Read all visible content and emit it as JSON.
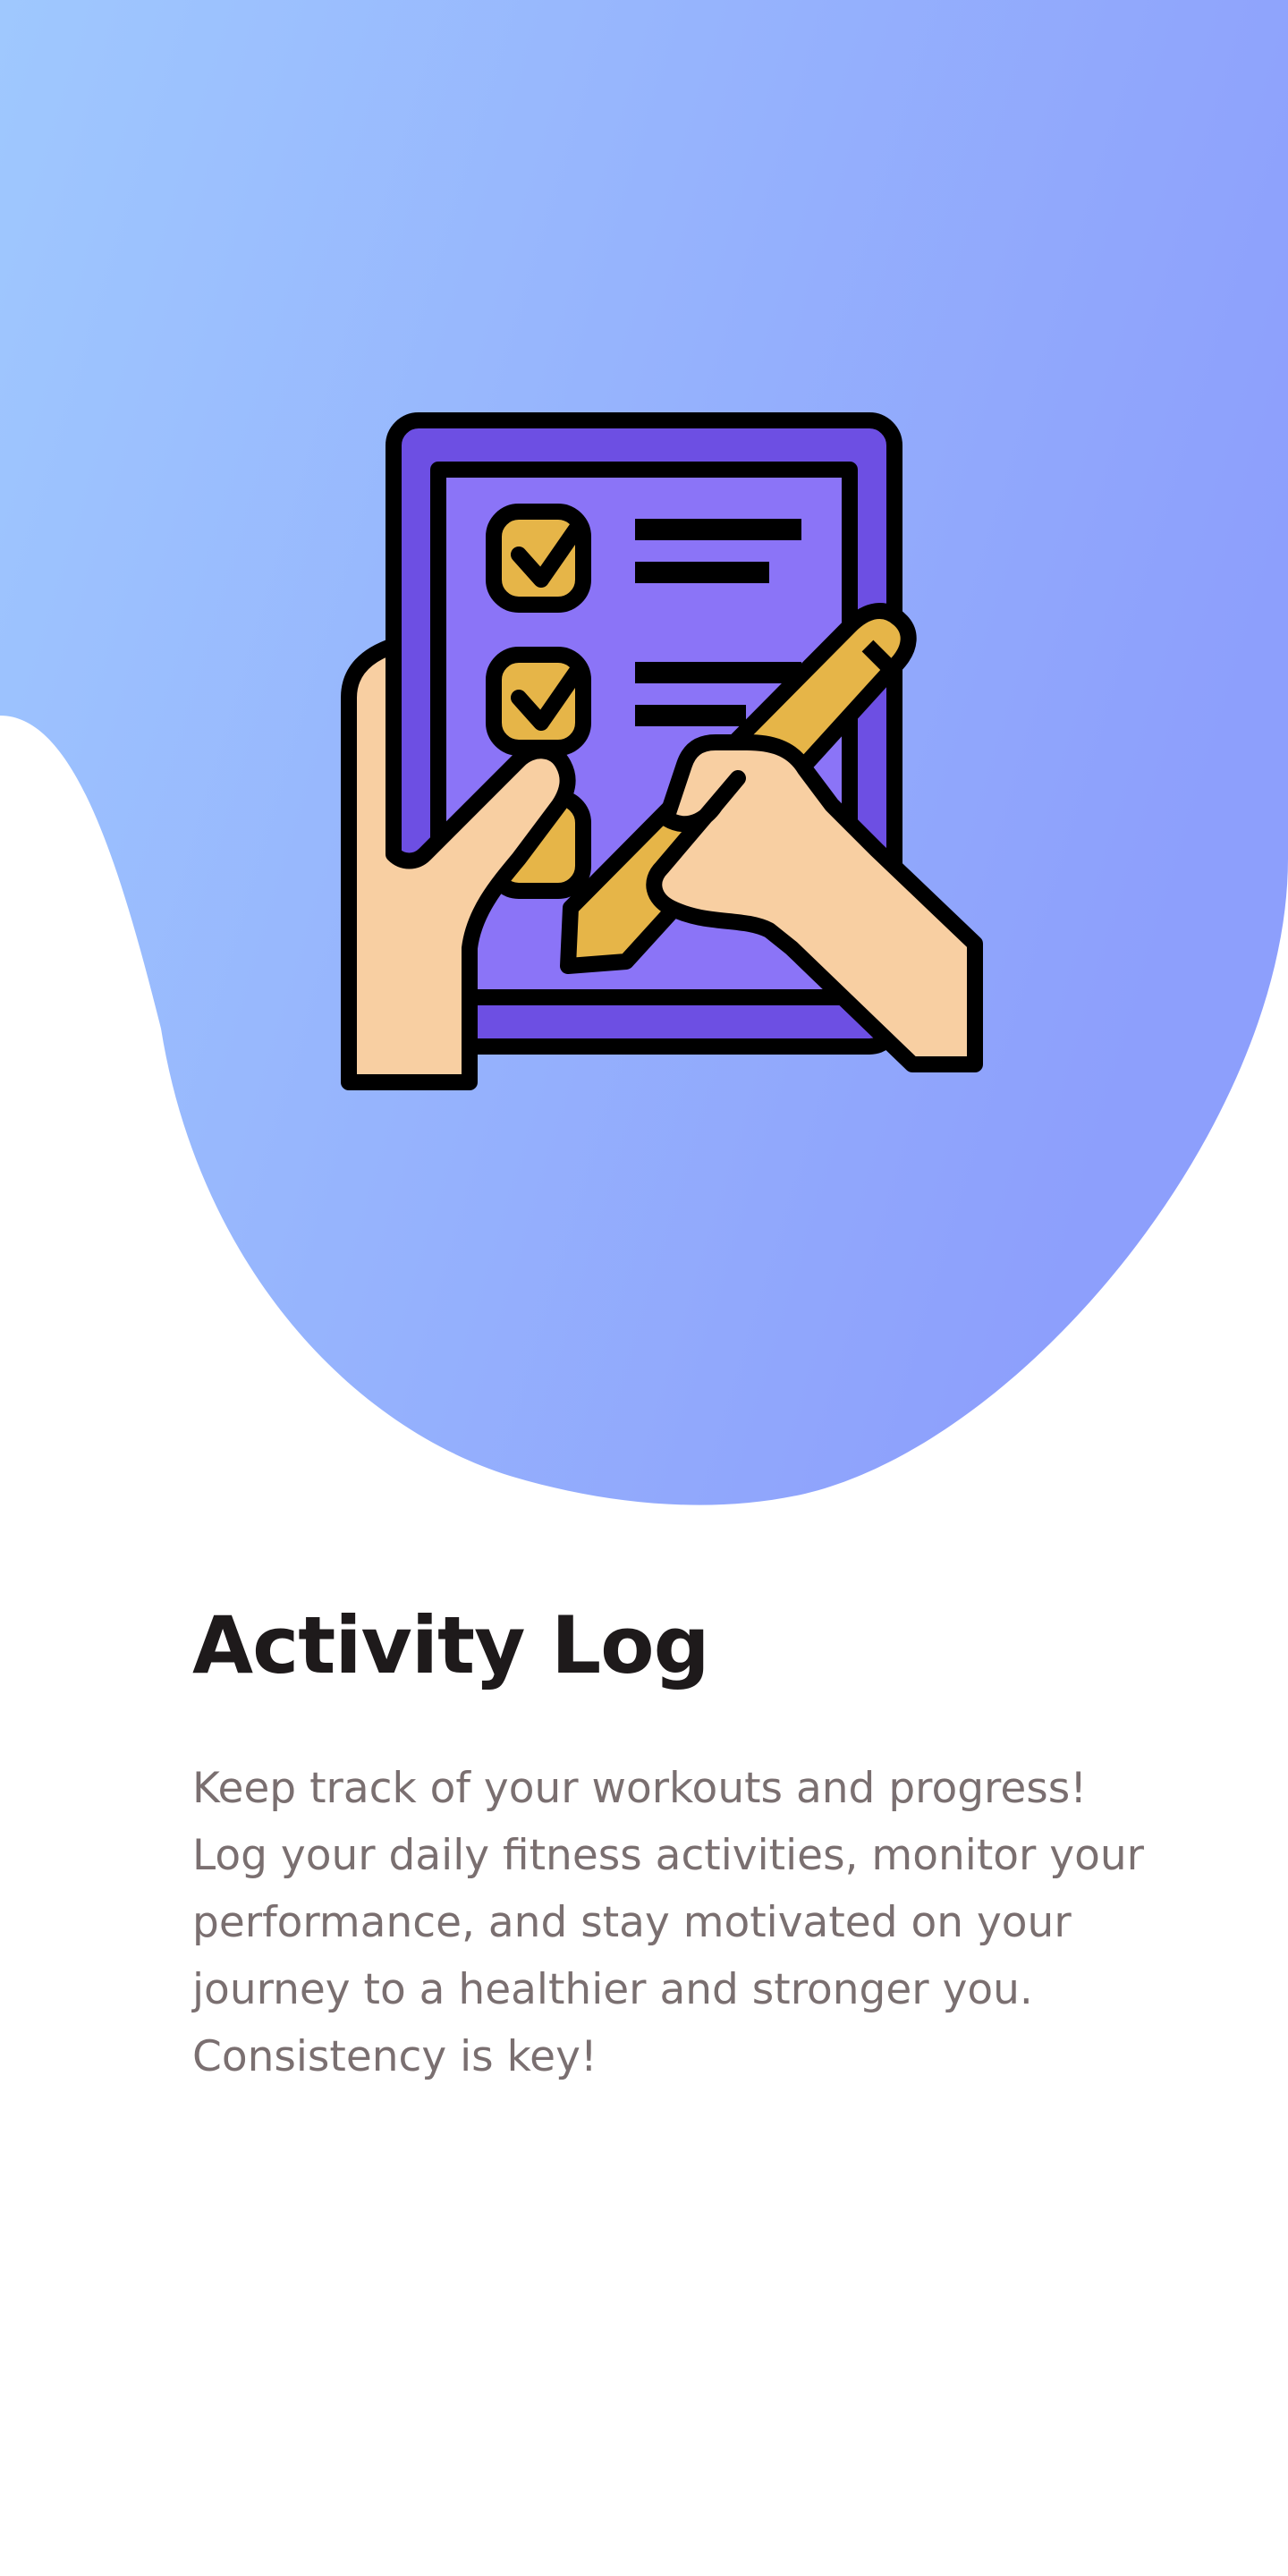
{
  "screen": {
    "title": "Activity Log",
    "description": "Keep track of your workouts and progress!\nLog your daily fitness activities, monitor your\nperformance, and stay motivated on your\njourney to a healthier and stronger you.\nConsistency is key!"
  },
  "illustration": {
    "icon": "checklist-clipboard-with-pencil-icon"
  },
  "colors": {
    "gradient_start": "#9fc8fe",
    "gradient_end": "#8d9ffc",
    "clipboard": "#8b74f7",
    "clipboard_dark": "#6d4fe3",
    "check_fill": "#e6b548",
    "skin": "#f8cfa2",
    "pencil": "#e6b548",
    "outline": "#000000",
    "title": "#1e1a1b",
    "body_text": "#7a6f70"
  }
}
